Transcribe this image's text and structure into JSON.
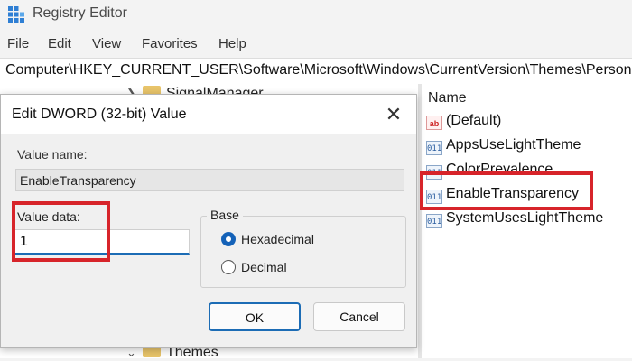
{
  "window": {
    "title": "Registry Editor",
    "icon": "registry-editor-icon"
  },
  "menu": {
    "items": [
      "File",
      "Edit",
      "View",
      "Favorites",
      "Help"
    ]
  },
  "address_bar": {
    "path": "Computer\\HKEY_CURRENT_USER\\Software\\Microsoft\\Windows\\CurrentVersion\\Themes\\Person"
  },
  "tree": {
    "items": [
      {
        "label": "SignalManager",
        "expander": "chevron-right"
      },
      {
        "label": "Themes",
        "expander": "chevron-down"
      }
    ]
  },
  "list": {
    "column_name": "Name",
    "entries": [
      {
        "name": "(Default)",
        "icon": "string-value-icon",
        "icon_glyph": "ab"
      },
      {
        "name": "AppsUseLightTheme",
        "icon": "dword-value-icon",
        "icon_glyph": "011"
      },
      {
        "name": "ColorPrevalence",
        "icon": "dword-value-icon",
        "icon_glyph": "011"
      },
      {
        "name": "EnableTransparency",
        "icon": "dword-value-icon",
        "icon_glyph": "011"
      },
      {
        "name": "SystemUsesLightTheme",
        "icon": "dword-value-icon",
        "icon_glyph": "011"
      }
    ]
  },
  "dialog": {
    "title": "Edit DWORD (32-bit) Value",
    "close_glyph": "✕",
    "value_name_label": "Value name:",
    "value_name": "EnableTransparency",
    "value_data_label": "Value data:",
    "value_data": "1",
    "base_label": "Base",
    "base_options": [
      {
        "label": "Hexadecimal",
        "selected": true
      },
      {
        "label": "Decimal",
        "selected": false
      }
    ],
    "ok_label": "OK",
    "cancel_label": "Cancel"
  },
  "colors": {
    "highlight": "#d7242a",
    "accent": "#1462b8"
  }
}
